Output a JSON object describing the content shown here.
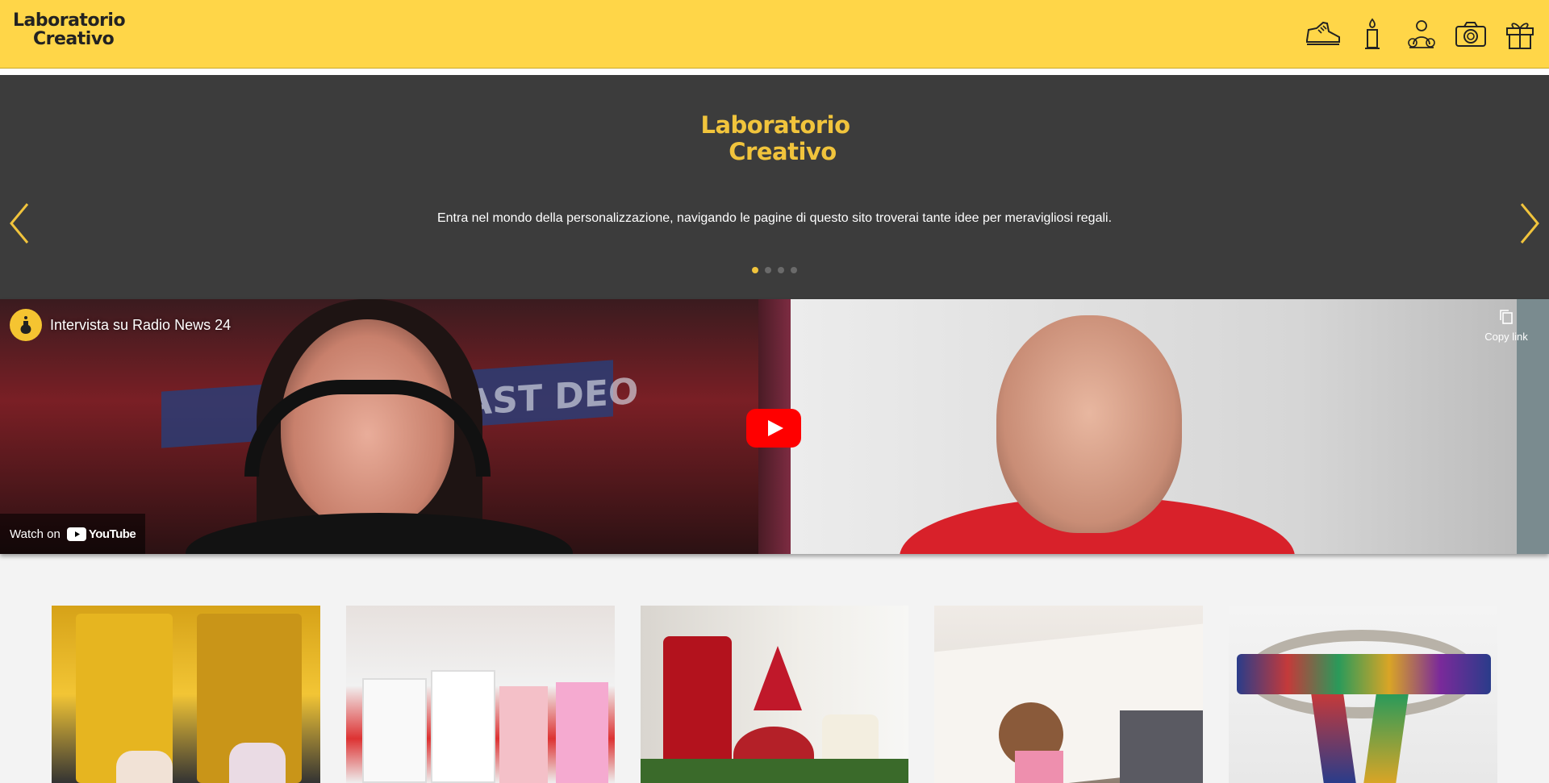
{
  "header": {
    "logo_line1": "Laboratorio",
    "logo_line2": "Creativo",
    "nav_icons": [
      "sneaker-icon",
      "candle-icon",
      "baby-toys-icon",
      "camera-icon",
      "gift-icon"
    ]
  },
  "hero": {
    "logo_line1": "Laboratorio",
    "logo_line2": "Creativo",
    "text": "Entra nel mondo della personalizzazione, navigando le pagine di questo sito troverai tante idee per meravigliosi regali.",
    "slide_count": 4,
    "active_slide": 1,
    "accent_color": "#f1c43c"
  },
  "video": {
    "title": "Intervista su Radio News 24",
    "copy_link_label": "Copy link",
    "watch_on_label": "Watch on",
    "youtube_label": "YouTube",
    "studio_sign": "ODCAST DEO"
  },
  "colors": {
    "header_bg": "#ffd648",
    "hero_bg": "#3c3c3c",
    "page_bg": "#f3f3f3",
    "youtube_red": "#ff0000"
  }
}
